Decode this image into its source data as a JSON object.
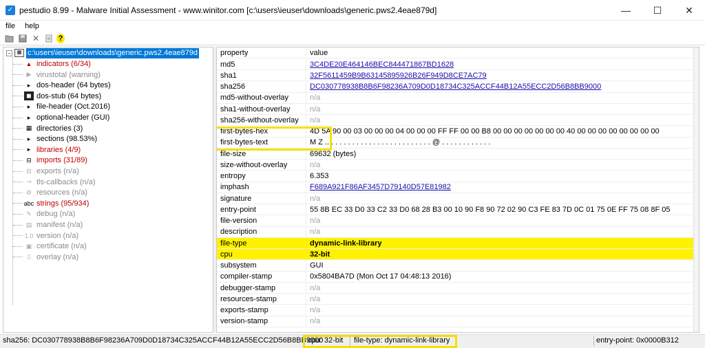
{
  "window": {
    "app_icon": "checkmark-icon",
    "title": "pestudio 8.99 - Malware Initial Assessment - www.winitor.com [c:\\users\\ieuser\\downloads\\generic.pws2.4eae879d]",
    "minimize": "—",
    "maximize": "☐",
    "close": "✕"
  },
  "menu": {
    "file": "file",
    "help": "help"
  },
  "toolbar": {
    "help_glyph": "?"
  },
  "tree": {
    "root": "c:\\users\\ieuser\\downloads\\generic.pws2.4eae879d",
    "items": [
      {
        "label": "indicators (6/34)",
        "color": "red",
        "icon": "indicators-icon"
      },
      {
        "label": "virustotal (warning)",
        "color": "grey",
        "icon": "virustotal-icon"
      },
      {
        "label": "dos-header (64 bytes)",
        "color": "black",
        "icon": "dos-header-icon"
      },
      {
        "label": "dos-stub (64 bytes)",
        "color": "black",
        "icon": "dos-stub-icon"
      },
      {
        "label": "file-header (Oct.2016)",
        "color": "black",
        "icon": "file-header-icon"
      },
      {
        "label": "optional-header (GUI)",
        "color": "black",
        "icon": "optional-header-icon"
      },
      {
        "label": "directories (3)",
        "color": "black",
        "icon": "directories-icon"
      },
      {
        "label": "sections (98.53%)",
        "color": "black",
        "icon": "sections-icon"
      },
      {
        "label": "libraries (4/9)",
        "color": "red",
        "icon": "libraries-icon"
      },
      {
        "label": "imports (31/89)",
        "color": "red",
        "icon": "imports-icon"
      },
      {
        "label": "exports (n/a)",
        "color": "grey",
        "icon": "exports-icon"
      },
      {
        "label": "tls-callbacks (n/a)",
        "color": "grey",
        "icon": "tls-callbacks-icon"
      },
      {
        "label": "resources (n/a)",
        "color": "grey",
        "icon": "resources-icon"
      },
      {
        "label": "strings (95/934)",
        "color": "red",
        "icon": "strings-icon"
      },
      {
        "label": "debug (n/a)",
        "color": "grey",
        "icon": "debug-icon"
      },
      {
        "label": "manifest (n/a)",
        "color": "grey",
        "icon": "manifest-icon"
      },
      {
        "label": "version (n/a)",
        "color": "grey",
        "icon": "version-icon"
      },
      {
        "label": "certificate (n/a)",
        "color": "grey",
        "icon": "certificate-icon"
      },
      {
        "label": "overlay (n/a)",
        "color": "grey",
        "icon": "overlay-icon"
      }
    ]
  },
  "grid": {
    "header": {
      "property": "property",
      "value": "value"
    },
    "rows": [
      {
        "property": "md5",
        "value": "3C4DE20E464146BEC844471867BD1628",
        "style": "link"
      },
      {
        "property": "sha1",
        "value": "32F5611459B9B63145895926B26F949D8CE7AC79",
        "style": "link"
      },
      {
        "property": "sha256",
        "value": "DC030778938B8B6F98236A709D0D18734C325ACCF44B12A55ECC2D56B8BB9000",
        "style": "link"
      },
      {
        "property": "md5-without-overlay",
        "value": "n/a",
        "style": "na"
      },
      {
        "property": "sha1-without-overlay",
        "value": "n/a",
        "style": "na"
      },
      {
        "property": "sha256-without-overlay",
        "value": "n/a",
        "style": "na"
      },
      {
        "property": "first-bytes-hex",
        "value": "4D 5A 90 00 03 00 00 00 04 00 00 00 FF FF 00 00 B8 00 00 00 00 00 00 00 40 00 00 00 00 00 00 00 00",
        "style": "plain"
      },
      {
        "property": "first-bytes-text",
        "value": "M Z .. . . . . . . . . . . . . . . . . . . . . . . . . @ . . . . . . . . . . . .",
        "style": "plain"
      },
      {
        "property": "file-size",
        "value": "69632 (bytes)",
        "style": "plain"
      },
      {
        "property": "size-without-overlay",
        "value": "n/a",
        "style": "na"
      },
      {
        "property": "entropy",
        "value": "6.353",
        "style": "plain"
      },
      {
        "property": "imphash",
        "value": "F689A921F86AF3457D79140D57E81982",
        "style": "link"
      },
      {
        "property": "signature",
        "value": "n/a",
        "style": "na"
      },
      {
        "property": "entry-point",
        "value": "55 8B EC 33 D0 33 C2 33 D0 68 28 B3 00 10 90 F8 90 72 02 90 C3 FE 83 7D 0C 01 75 0E FF 75 08 8F 05",
        "style": "plain"
      },
      {
        "property": "file-version",
        "value": "n/a",
        "style": "na"
      },
      {
        "property": "description",
        "value": "n/a",
        "style": "na"
      },
      {
        "property": "file-type",
        "value": "dynamic-link-library",
        "style": "highlight"
      },
      {
        "property": "cpu",
        "value": "32-bit",
        "style": "highlight"
      },
      {
        "property": "subsystem",
        "value": "GUI",
        "style": "plain"
      },
      {
        "property": "compiler-stamp",
        "value": "0x5804BA7D (Mon Oct 17 04:48:13 2016)",
        "style": "plain"
      },
      {
        "property": "debugger-stamp",
        "value": "n/a",
        "style": "na"
      },
      {
        "property": "resources-stamp",
        "value": "n/a",
        "style": "na"
      },
      {
        "property": "exports-stamp",
        "value": "n/a",
        "style": "na"
      },
      {
        "property": "version-stamp",
        "value": "n/a",
        "style": "na"
      }
    ]
  },
  "status": {
    "sha256": "sha256: DC030778938B8B6F98236A709D0D18734C325ACCF44B12A55ECC2D56B8BB9000",
    "cpu": "cpu: 32-bit",
    "file_type": "file-type: dynamic-link-library",
    "entry_point": "entry-point: 0x0000B312"
  },
  "colors": {
    "highlight": "#fff200",
    "selection": "#0078d7",
    "link": "#1a0dab",
    "alert": "#c00000",
    "muted": "#8a8a8a"
  }
}
